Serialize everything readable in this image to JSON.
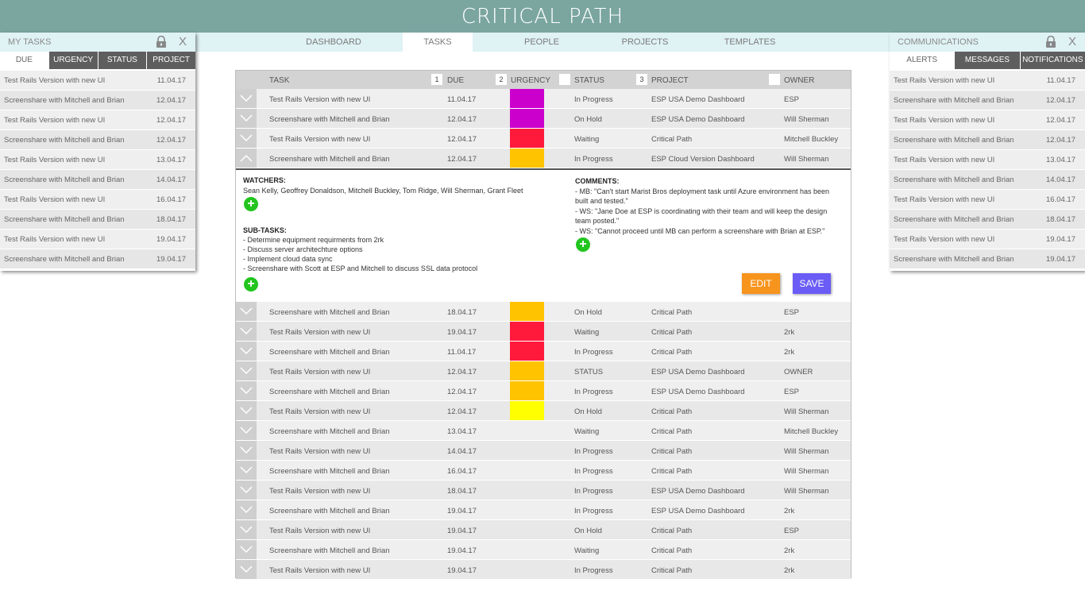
{
  "app": {
    "title": "CRITICAL PATH"
  },
  "nav": {
    "tabs": [
      "DASHBOARD",
      "TASKS",
      "PEOPLE",
      "PROJECTS",
      "TEMPLATES"
    ],
    "active": "TASKS"
  },
  "my_tasks": {
    "title": "MY TASKS",
    "close": "X",
    "tabs": [
      "DUE",
      "URGENCY",
      "STATUS",
      "PROJECT"
    ],
    "active_tab": "DUE",
    "rows": [
      {
        "task": "Test Rails Version with new UI",
        "date": "11.04.17"
      },
      {
        "task": "Screenshare with Mitchell and Brian",
        "date": "12.04.17"
      },
      {
        "task": "Test Rails Version with new UI",
        "date": "12.04.17"
      },
      {
        "task": "Screenshare with Mitchell and Brian",
        "date": "12.04.17"
      },
      {
        "task": "Test Rails Version with new UI",
        "date": "13.04.17"
      },
      {
        "task": "Screenshare with Mitchell and Brian",
        "date": "14.04.17"
      },
      {
        "task": "Test Rails Version with new UI",
        "date": "16.04.17"
      },
      {
        "task": "Screenshare with Mitchell and Brian",
        "date": "18.04.17"
      },
      {
        "task": "Test Rails Version with new UI",
        "date": "19.04.17"
      },
      {
        "task": "Screenshare with Mitchell and Brian",
        "date": "19.04.17"
      }
    ]
  },
  "communications": {
    "title": "COMMUNICATIONS",
    "close": "X",
    "tabs": [
      "ALERTS",
      "MESSAGES",
      "NOTIFICATIONS"
    ],
    "active_tab": "ALERTS",
    "rows": [
      {
        "task": "Test Rails Version with new UI",
        "date": "11.04.17"
      },
      {
        "task": "Screenshare with Mitchell and Brian",
        "date": "12.04.17"
      },
      {
        "task": "Test Rails Version with new UI",
        "date": "12.04.17"
      },
      {
        "task": "Screenshare with Mitchell and Brian",
        "date": "12.04.17"
      },
      {
        "task": "Test Rails Version with new UI",
        "date": "13.04.17"
      },
      {
        "task": "Screenshare with Mitchell and Brian",
        "date": "14.04.17"
      },
      {
        "task": "Test Rails Version with new UI",
        "date": "16.04.17"
      },
      {
        "task": "Screenshare with Mitchell and Brian",
        "date": "18.04.17"
      },
      {
        "task": "Test Rails Version with new UI",
        "date": "19.04.17"
      },
      {
        "task": "Screenshare with Mitchell and Brian",
        "date": "19.04.17"
      }
    ]
  },
  "table": {
    "headers": {
      "task": "TASK",
      "due": "DUE",
      "urgency": "URGENCY",
      "status": "STATUS",
      "project": "PROJECT",
      "owner": "OWNER"
    },
    "sort_order": {
      "due": "1",
      "urgency": "2",
      "status": "",
      "project": "3",
      "owner": ""
    },
    "rows_before": [
      {
        "task": "Test Rails Version with new UI",
        "due": "11.04.17",
        "urgency": "#cc00cc",
        "status": "In Progress",
        "project": "ESP USA Demo Dashboard",
        "owner": "ESP"
      },
      {
        "task": "Screenshare with Mitchell and Brian",
        "due": "12.04.17",
        "urgency": "#cc00cc",
        "status": "On Hold",
        "project": "ESP USA Demo Dashboard",
        "owner": "Will Sherman"
      },
      {
        "task": "Test Rails Version with new UI",
        "due": "12.04.17",
        "urgency": "#ff1a3c",
        "status": "Waiting",
        "project": "Critical Path",
        "owner": "Mitchell Buckley"
      },
      {
        "task": "Screenshare with Mitchell and Brian",
        "due": "12.04.17",
        "urgency": "#ffc300",
        "status": "In Progress",
        "project": "ESP Cloud Version Dashboard",
        "owner": "Will Sherman",
        "expanded": true
      }
    ],
    "detail": {
      "watchers_label": "WATCHERS:",
      "watchers": "Sean Kelly, Geoffrey Donaldson, Mitchell Buckley, Tom Ridge, Will Sherman, Grant Fleet",
      "subtasks_label": "SUB-TASKS:",
      "subtasks": [
        "- Determine equipment requirments from 2rk",
        "- Discuss server architechture options",
        "- Implement cloud data sync",
        "- Screenshare with Scott at ESP and Mitchell to discuss SSL data protocol"
      ],
      "comments_label": "COMMENTS:",
      "comments": [
        "- MB: \"Can't start Marist Bros deployment task until Azure environment has been",
        "built and tested.\"",
        "- WS: \"Jane Doe at ESP is coordinating with their team and will keep the design",
        "team posted.\"",
        "- WS: \"Cannot proceed until MB can perform a screenshare with Brian at ESP.\""
      ],
      "edit_label": "EDIT",
      "save_label": "SAVE"
    },
    "rows_after": [
      {
        "task": "Screenshare with Mitchell and Brian",
        "due": "18.04.17",
        "urgency": "#ffc300",
        "status": "On Hold",
        "project": "Critical Path",
        "owner": "ESP"
      },
      {
        "task": "Test Rails Version with new UI",
        "due": "19.04.17",
        "urgency": "#ff1a3c",
        "status": "Waiting",
        "project": "Critical Path",
        "owner": "2rk"
      },
      {
        "task": "Screenshare with Mitchell and Brian",
        "due": "11.04.17",
        "urgency": "#ff1a3c",
        "status": "In Progress",
        "project": "Critical Path",
        "owner": "2rk"
      },
      {
        "task": "Test Rails Version with new UI",
        "due": "12.04.17",
        "urgency": "#ffc300",
        "status": "STATUS",
        "project": "ESP USA Demo Dashboard",
        "owner": "OWNER"
      },
      {
        "task": "Screenshare with Mitchell and Brian",
        "due": "12.04.17",
        "urgency": "#ffc300",
        "status": "In Progress",
        "project": "ESP USA Demo Dashboard",
        "owner": "ESP"
      },
      {
        "task": "Test Rails Version with new UI",
        "due": "12.04.17",
        "urgency": "#ffff00",
        "status": "On Hold",
        "project": "Critical Path",
        "owner": "Will Sherman"
      },
      {
        "task": "Screenshare with Mitchell and Brian",
        "due": "13.04.17",
        "urgency": "",
        "status": "Waiting",
        "project": "Critical Path",
        "owner": "Mitchell Buckley"
      },
      {
        "task": "Test Rails Version with new UI",
        "due": "14.04.17",
        "urgency": "",
        "status": "In Progress",
        "project": "Critical Path",
        "owner": "Will Sherman"
      },
      {
        "task": "Screenshare with Mitchell and Brian",
        "due": "16.04.17",
        "urgency": "",
        "status": "In Progress",
        "project": "Critical Path",
        "owner": "Will Sherman"
      },
      {
        "task": "Test Rails Version with new UI",
        "due": "18.04.17",
        "urgency": "",
        "status": "In Progress",
        "project": "ESP USA Demo Dashboard",
        "owner": "Will Sherman"
      },
      {
        "task": "Screenshare with Mitchell and Brian",
        "due": "19.04.17",
        "urgency": "",
        "status": "In Progress",
        "project": "ESP USA Demo Dashboard",
        "owner": "2rk"
      },
      {
        "task": "Test Rails Version with new UI",
        "due": "19.04.17",
        "urgency": "",
        "status": "On Hold",
        "project": "Critical Path",
        "owner": "ESP"
      },
      {
        "task": "Screenshare with Mitchell and Brian",
        "due": "19.04.17",
        "urgency": "",
        "status": "Waiting",
        "project": "Critical Path",
        "owner": "2rk"
      },
      {
        "task": "Test Rails Version with new UI",
        "due": "19.04.17",
        "urgency": "",
        "status": "In Progress",
        "project": "Critical Path",
        "owner": "2rk"
      }
    ]
  },
  "icons": {
    "lock": "lock-icon",
    "close": "close-icon",
    "chevron": "chevron-down-icon",
    "add": "plus-icon"
  }
}
